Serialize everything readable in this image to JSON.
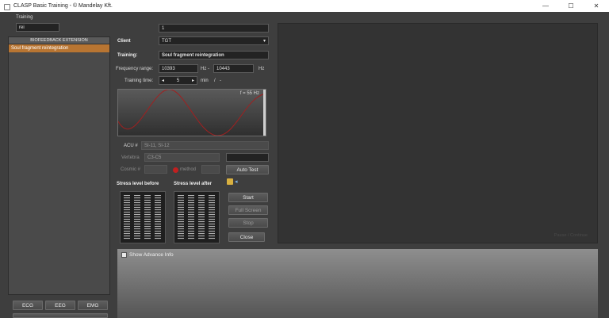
{
  "window": {
    "title": "CLASP Basic Training - © Mandelay Kft.",
    "minimize": "—",
    "maximize": "☐",
    "close": "✕"
  },
  "sidebar": {
    "training_label": "Training",
    "training_value": "rei",
    "list_header": "BIOFEEDBACK EXTENSION",
    "list_items": [
      "Soul fragment reintegration"
    ],
    "buttons": [
      "ECG",
      "EEG",
      "EMG"
    ]
  },
  "form": {
    "top_field_value": "1",
    "client_label": "Client",
    "client_value": "TGT",
    "training_label": "Training:",
    "training_value": "Soul fragment reintegration",
    "freq_label": "Frequency range:",
    "freq_from": "10393",
    "freq_hz_dash": "Hz -",
    "freq_to": "10443",
    "freq_hz": "Hz",
    "time_label": "Training time:",
    "time_value": "5",
    "time_unit": "min",
    "time_slash": "/",
    "time_dash": "-",
    "wave_label": "f = 55 Hz",
    "acu_label": "ACU #",
    "acu_value": "SI-11, SI-12",
    "vertebra_label": "Vertebra",
    "vertebra_value": "C3-C5",
    "cosmic_label": "Cosmic #",
    "method_label": "method",
    "auto_test": "Auto Test",
    "stress_before": "Stress level before",
    "stress_after": "Stress level after",
    "start": "Start",
    "full_screen": "Full Screen",
    "stop": "Stop",
    "close": "Close",
    "show_advance": "Show Advance Info"
  },
  "display": {
    "pause_text": "Pause / Continue"
  }
}
